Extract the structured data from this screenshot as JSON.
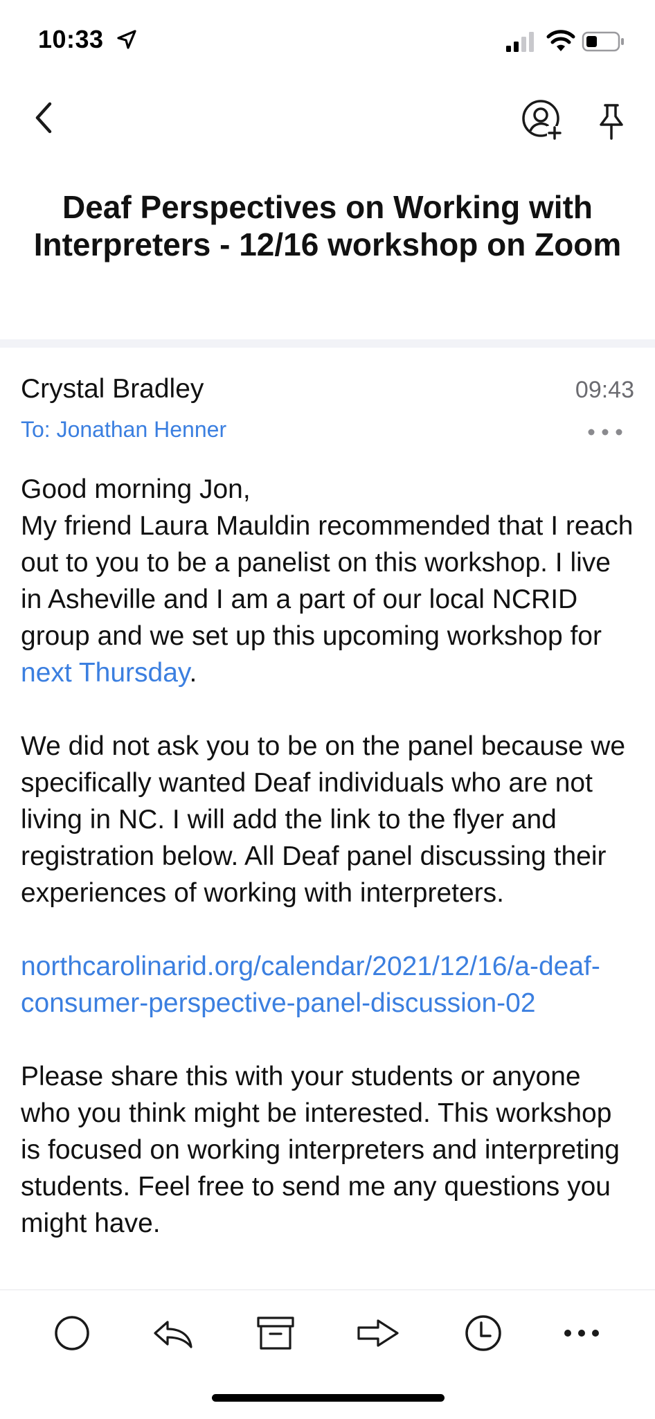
{
  "status_bar": {
    "time": "10:33",
    "icons": [
      "location-arrow-icon",
      "cellular-signal-icon",
      "wifi-icon",
      "battery-icon"
    ]
  },
  "nav": {
    "icons": [
      "chevron-left-icon",
      "add-person-icon",
      "pin-icon"
    ]
  },
  "email": {
    "subject": "Deaf Perspectives on Working with Interpreters - 12/16 workshop on Zoom",
    "sender": "Crystal Bradley",
    "time": "09:43",
    "recipient": "To: Jonathan Henner",
    "body": {
      "greeting": "Good morning Jon,",
      "p1_text": "My friend Laura Mauldin recommended that I reach out to you to be a panelist on this workshop. I live in Asheville and I am a part of our local NCRID group and we set up this upcoming workshop for ",
      "p1_link": "next Thursday",
      "p1_end": ".",
      "p2": "We did not ask you to be on the panel because we specifically wanted Deaf individuals who are not living in NC. I will add the link to the flyer and registration below. All Deaf panel discussing their experiences of working with interpreters.",
      "link": "northcarolinarid.org/calendar/2021/12/16/a-deaf-consumer-perspective-panel-discussion-02",
      "p3": "Please share this with your students or anyone who you think might be interested. This workshop is focused on working interpreters and interpreting students. Feel free to send me any questions you might have."
    }
  },
  "toolbar": {
    "icons": [
      "circle-icon",
      "reply-icon",
      "archive-icon",
      "forward-icon",
      "clock-icon",
      "more-icon"
    ]
  },
  "colors": {
    "accent": "#3b7fe0",
    "muted": "#6b6b70",
    "band": "#f2f3f7"
  }
}
